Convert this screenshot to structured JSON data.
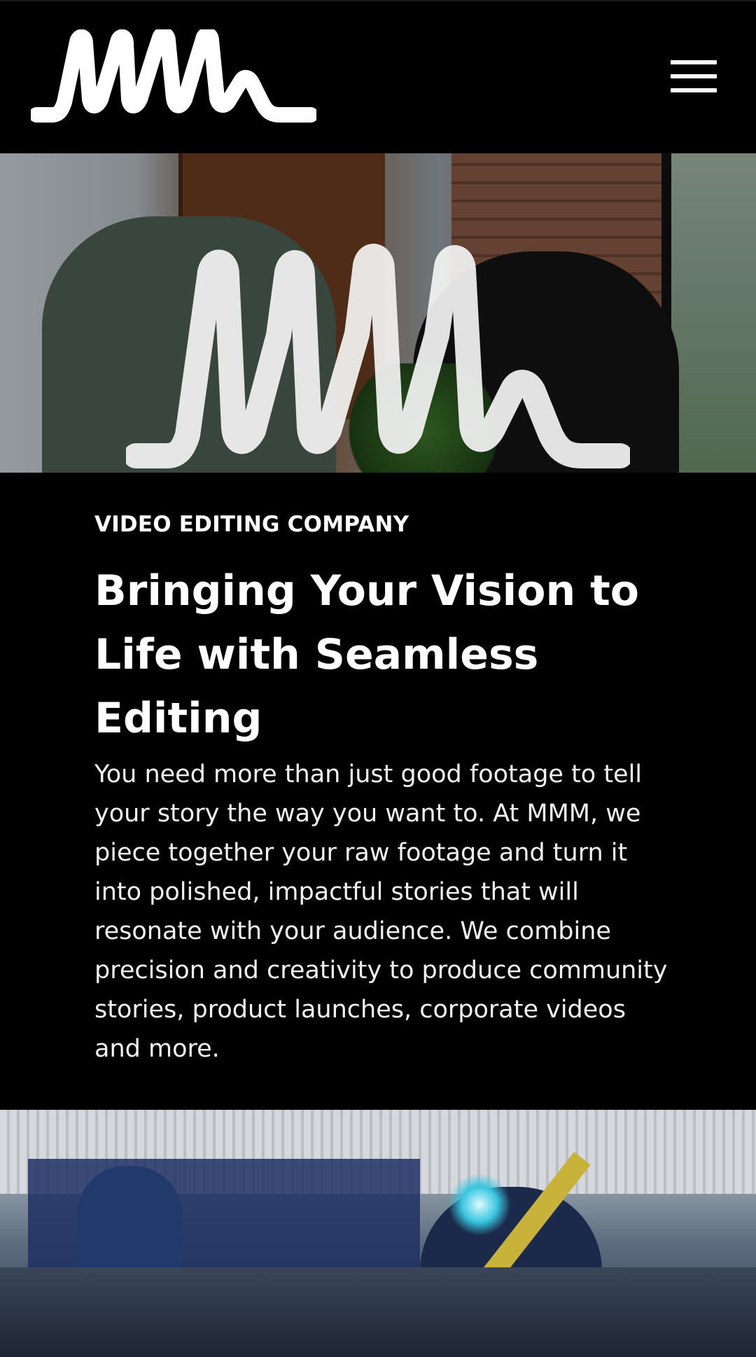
{
  "header": {
    "logo_alt": "MMM",
    "menu_label": "Menu"
  },
  "hero": {
    "logo_alt": "MMM"
  },
  "content": {
    "eyebrow": "VIDEO EDITING COMPANY",
    "headline": "Bringing Your Vision to Life with Seamless Editing",
    "body": "You need more than just good footage to tell your story the way you want to. At MMM, we piece together your raw footage and turn it into polished, impactful stories that will resonate with your audience. We combine precision and creativity to produce community stories, product launches, corporate videos and more."
  },
  "colors": {
    "background": "#000000",
    "text": "#ffffff",
    "logo": "#ffffff"
  },
  "icons": {
    "menu": "hamburger-icon"
  }
}
